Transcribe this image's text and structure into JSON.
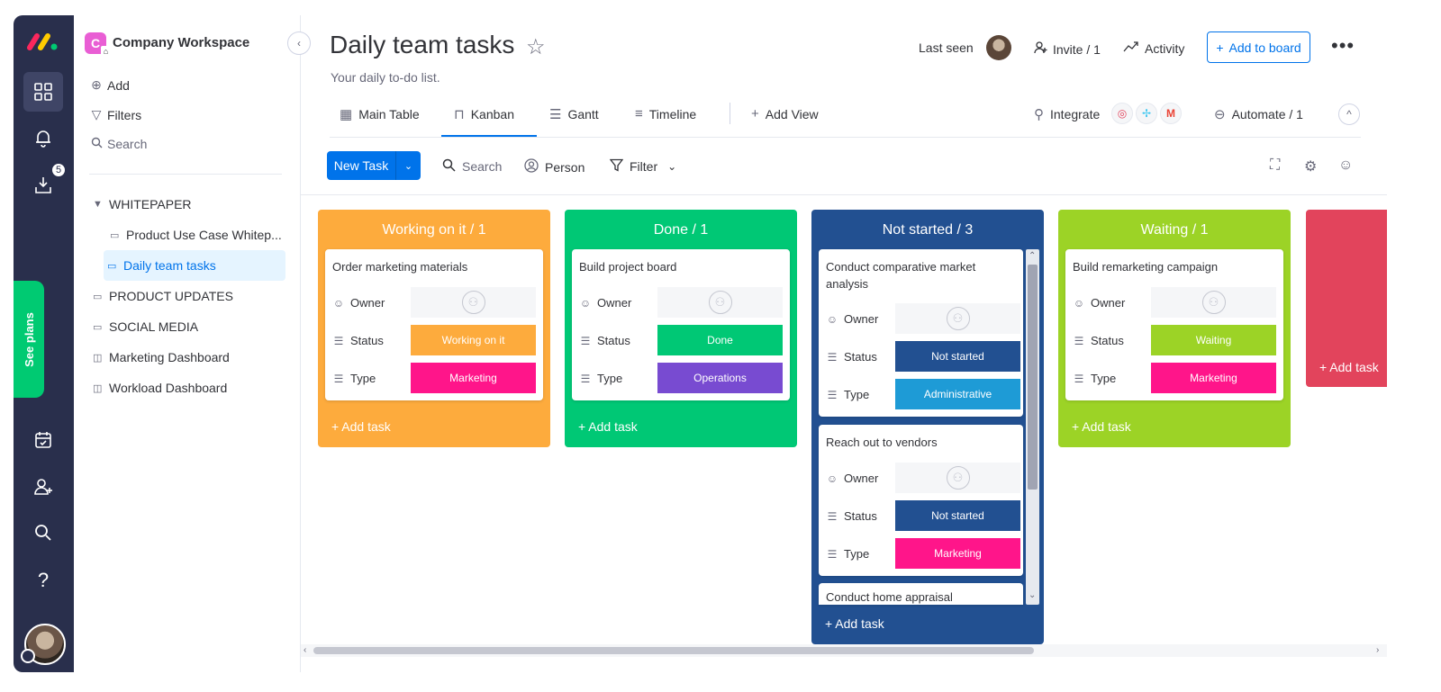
{
  "rail": {
    "notification_count": "5",
    "see_plans": "See plans",
    "icons": [
      "monday-logo",
      "workspaces-icon",
      "bell-icon",
      "inbox-icon",
      "calendar-icon",
      "invite-icon",
      "search-icon",
      "help-icon"
    ]
  },
  "sidebar": {
    "workspace_initial": "C",
    "workspace_name": "Company Workspace",
    "actions": {
      "add": "Add",
      "filters": "Filters",
      "search": "Search"
    },
    "folder": "WHITEPAPER",
    "items": [
      {
        "label": "Product Use Case Whitep..."
      },
      {
        "label": "Daily team tasks"
      },
      {
        "label": "PRODUCT UPDATES"
      },
      {
        "label": "SOCIAL MEDIA"
      },
      {
        "label": "Marketing Dashboard"
      },
      {
        "label": "Workload Dashboard"
      }
    ]
  },
  "header": {
    "title": "Daily team tasks",
    "description": "Your daily to-do list.",
    "last_seen": "Last seen",
    "invite": "Invite / 1",
    "activity": "Activity",
    "add_to_board": "Add to board"
  },
  "views": {
    "tabs": [
      "Main Table",
      "Kanban",
      "Gantt",
      "Timeline"
    ],
    "active": "Kanban",
    "add_view": "Add View",
    "integrate": "Integrate",
    "automate": "Automate / 1"
  },
  "toolbar": {
    "new_task": "New Task",
    "search": "Search",
    "person": "Person",
    "filter": "Filter"
  },
  "fields": {
    "owner": "Owner",
    "status": "Status",
    "type": "Type"
  },
  "add_task": "+ Add task",
  "colors": {
    "working": "#fdab3d",
    "done": "#00c875",
    "not_started": "#225091",
    "waiting": "#9cd326",
    "stuck": "#e2445c",
    "marketing": "#ff158a",
    "operations": "#784bd1",
    "administrative": "#1e9bd6",
    "accent": "#0073ea"
  },
  "columns": [
    {
      "title": "Working on it / 1",
      "cards": [
        {
          "title": "Order marketing materials",
          "status": "Working on it",
          "type": "Marketing"
        }
      ]
    },
    {
      "title": "Done / 1",
      "cards": [
        {
          "title": "Build project board",
          "status": "Done",
          "type": "Operations"
        }
      ]
    },
    {
      "title": "Not started / 3",
      "cards": [
        {
          "title": "Conduct comparative market analysis",
          "status": "Not started",
          "type": "Administrative"
        },
        {
          "title": "Reach out to vendors",
          "status": "Not started",
          "type": "Marketing"
        },
        {
          "title": "Conduct home appraisal"
        }
      ]
    },
    {
      "title": "Waiting / 1",
      "cards": [
        {
          "title": "Build remarketing campaign",
          "status": "Waiting",
          "type": "Marketing"
        }
      ]
    }
  ]
}
